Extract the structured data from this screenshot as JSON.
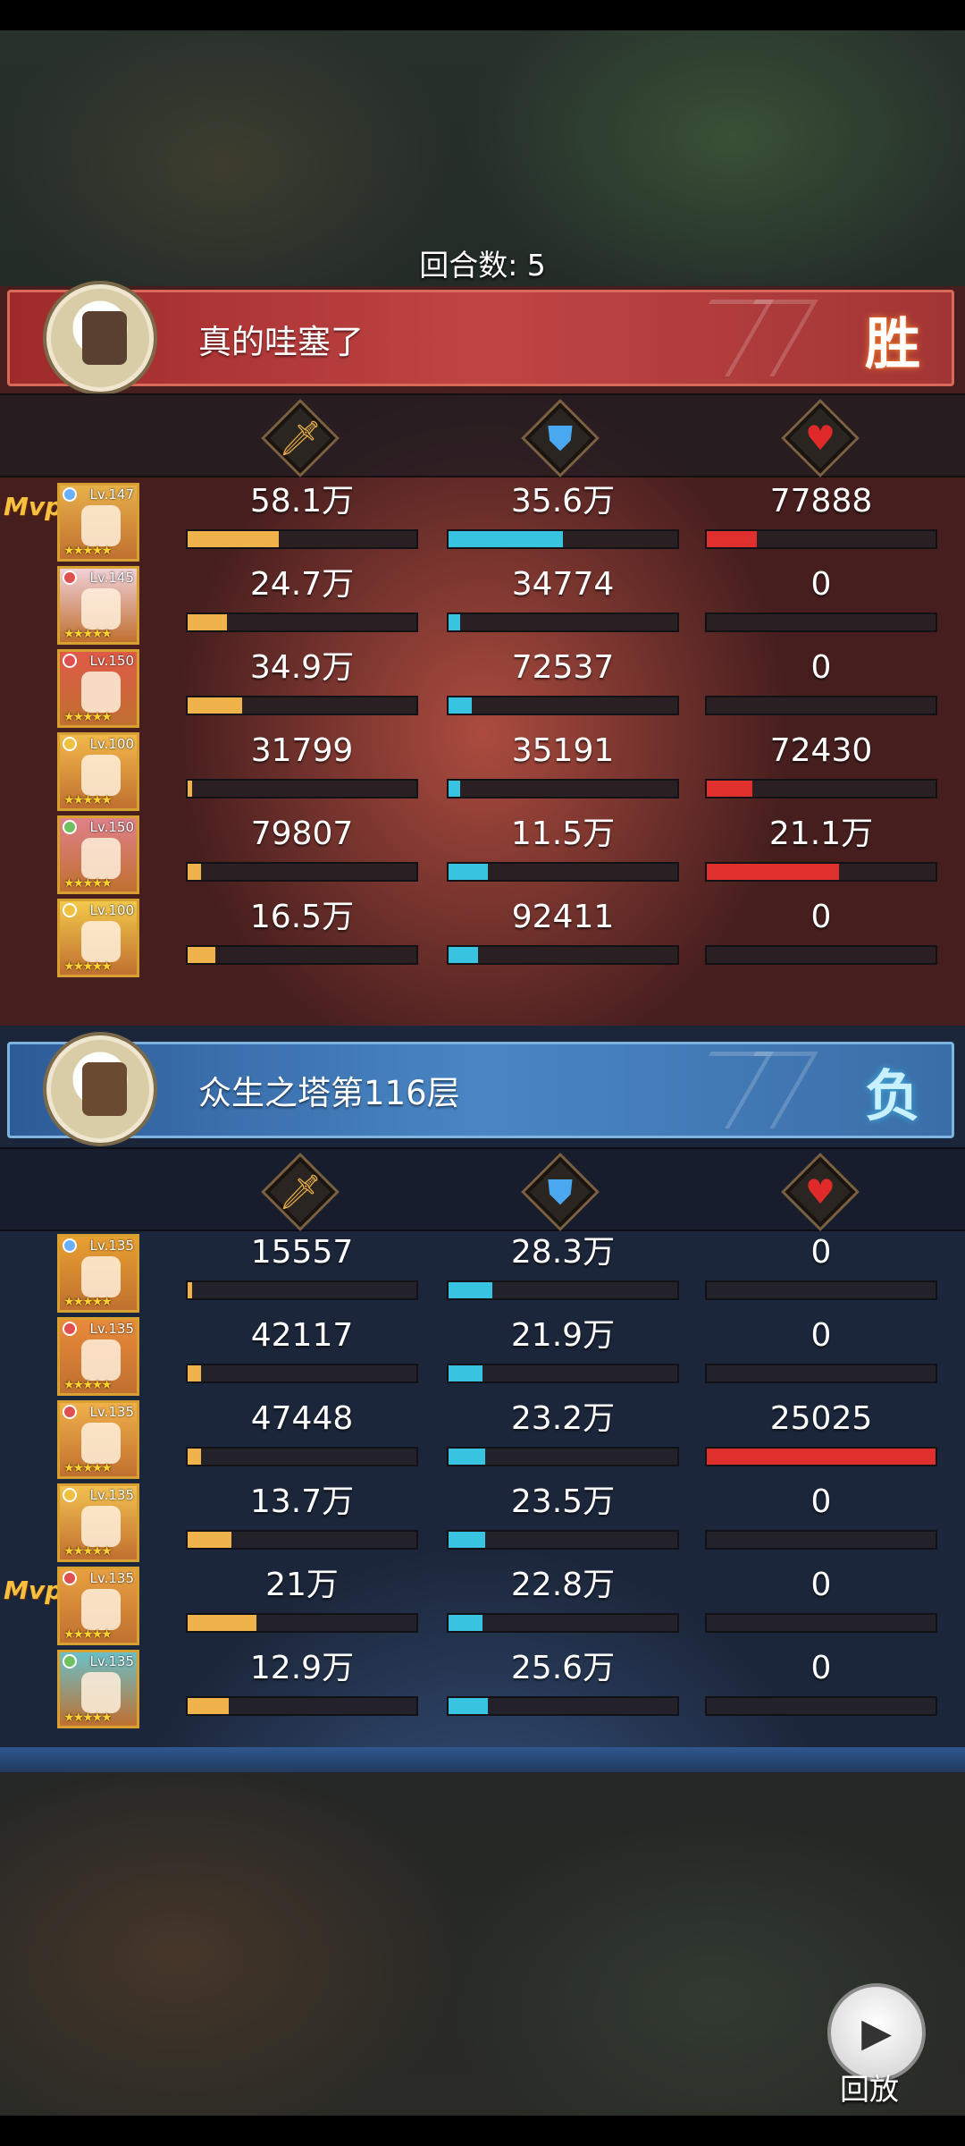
{
  "round": "回合数: 5",
  "teams": [
    {
      "name": "真的哇塞了",
      "result": "胜",
      "heroes": [
        {
          "lv": "Lv.147",
          "mvp": "Mvp",
          "atk": "58.1万",
          "def": "35.6万",
          "hp": "77888",
          "atk_pct": 40,
          "def_pct": 50,
          "hp_pct": 22,
          "color": "#e8b04a",
          "elem": "#6ab0ff"
        },
        {
          "lv": "Lv.145",
          "mvp": "",
          "atk": "24.7万",
          "def": "34774",
          "hp": "0",
          "atk_pct": 17,
          "def_pct": 5,
          "hp_pct": 0,
          "color": "#f0d0d8",
          "elem": "#e05050"
        },
        {
          "lv": "Lv.150",
          "mvp": "",
          "atk": "34.9万",
          "def": "72537",
          "hp": "0",
          "atk_pct": 24,
          "def_pct": 10,
          "hp_pct": 0,
          "color": "#e05a48",
          "elem": "#e05050"
        },
        {
          "lv": "Lv.100",
          "mvp": "",
          "atk": "31799",
          "def": "35191",
          "hp": "72430",
          "atk_pct": 2,
          "def_pct": 5,
          "hp_pct": 20,
          "color": "#f2b84a",
          "elem": "#f0c040"
        },
        {
          "lv": "Lv.150",
          "mvp": "",
          "atk": "79807",
          "def": "11.5万",
          "hp": "21.1万",
          "atk_pct": 6,
          "def_pct": 17,
          "hp_pct": 58,
          "color": "#e0808a",
          "elem": "#70c060"
        },
        {
          "lv": "Lv.100",
          "mvp": "",
          "atk": "16.5万",
          "def": "92411",
          "hp": "0",
          "atk_pct": 12,
          "def_pct": 13,
          "hp_pct": 0,
          "color": "#f2c84a",
          "elem": "#f0c040"
        }
      ]
    },
    {
      "name": "众生之塔第116层",
      "result": "负",
      "heroes": [
        {
          "lv": "Lv.135",
          "mvp": "",
          "atk": "15557",
          "def": "28.3万",
          "hp": "0",
          "atk_pct": 2,
          "def_pct": 19,
          "hp_pct": 0,
          "color": "#e8a030",
          "elem": "#6ab0ff"
        },
        {
          "lv": "Lv.135",
          "mvp": "",
          "atk": "42117",
          "def": "21.9万",
          "hp": "0",
          "atk_pct": 6,
          "def_pct": 15,
          "hp_pct": 0,
          "color": "#e88a3a",
          "elem": "#e05050"
        },
        {
          "lv": "Lv.135",
          "mvp": "",
          "atk": "47448",
          "def": "23.2万",
          "hp": "25025",
          "atk_pct": 6,
          "def_pct": 16,
          "hp_pct": 100,
          "color": "#f0b04a",
          "elem": "#e05050"
        },
        {
          "lv": "Lv.135",
          "mvp": "",
          "atk": "13.7万",
          "def": "23.5万",
          "hp": "0",
          "atk_pct": 19,
          "def_pct": 16,
          "hp_pct": 0,
          "color": "#f2c050",
          "elem": "#f0c040"
        },
        {
          "lv": "Lv.135",
          "mvp": "Mvp",
          "atk": "21万",
          "def": "22.8万",
          "hp": "0",
          "atk_pct": 30,
          "def_pct": 15,
          "hp_pct": 0,
          "color": "#e8a040",
          "elem": "#e05050"
        },
        {
          "lv": "Lv.135",
          "mvp": "",
          "atk": "12.9万",
          "def": "25.6万",
          "hp": "0",
          "atk_pct": 18,
          "def_pct": 17,
          "hp_pct": 0,
          "color": "#6ac0c8",
          "elem": "#70c060"
        }
      ]
    }
  ],
  "icons": {
    "attack": "sword-icon",
    "defense": "shield-icon",
    "heal": "heart-icon"
  },
  "replay": {
    "label": "回放",
    "icon": "video-camera-icon"
  },
  "colors": {
    "attack": "#f0b24a",
    "defense": "#38c4e0",
    "heal": "#e0302e",
    "win": "#c04444",
    "lose": "#4a86c4"
  }
}
